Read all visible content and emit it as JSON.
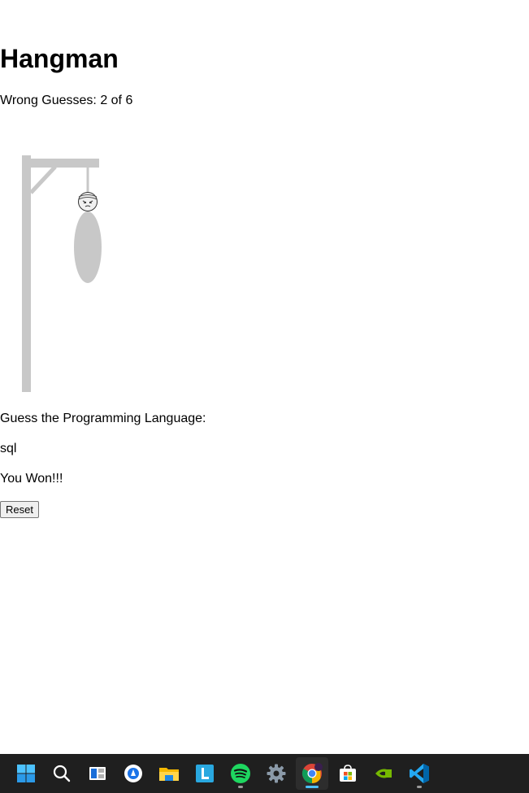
{
  "game": {
    "title": "Hangman",
    "wrong_guesses": "Wrong Guesses: 2 of 6",
    "prompt": "Guess the Programming Language:",
    "word": "sql",
    "status": "You Won!!!",
    "reset_label": "Reset",
    "wrong_count": 2,
    "max_wrong": 6
  },
  "taskbar": {
    "items": [
      {
        "icon": "windows-start-icon"
      },
      {
        "icon": "search-icon"
      },
      {
        "icon": "task-view-icon"
      },
      {
        "icon": "app-circle-icon"
      },
      {
        "icon": "file-explorer-icon"
      },
      {
        "icon": "l-app-icon"
      },
      {
        "icon": "spotify-icon"
      },
      {
        "icon": "settings-gear-icon"
      },
      {
        "icon": "chrome-icon"
      },
      {
        "icon": "microsoft-store-icon"
      },
      {
        "icon": "nvidia-icon"
      },
      {
        "icon": "vscode-icon"
      }
    ]
  },
  "colors": {
    "gallows": "#c8c8c8",
    "taskbar_bg": "#1f1f1f"
  }
}
